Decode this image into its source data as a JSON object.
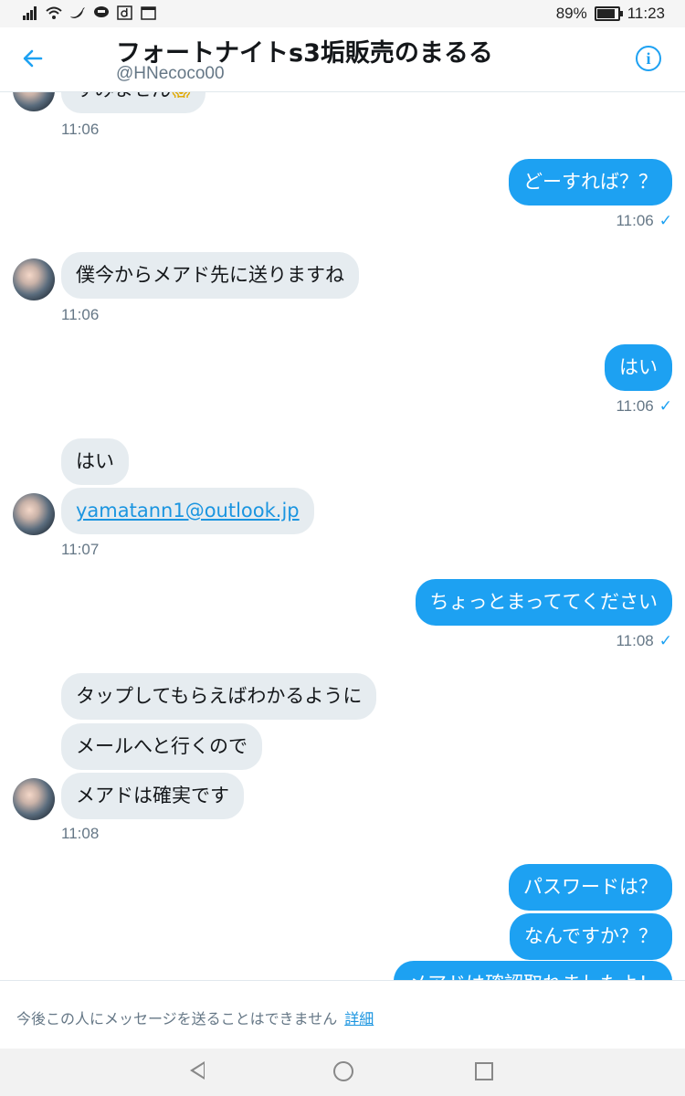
{
  "status_bar": {
    "battery": "89%",
    "time": "11:23"
  },
  "header": {
    "title": "フォートナイトs3垢販売のまるる",
    "handle": "@HNecoco00",
    "back_icon": "arrow-left-icon",
    "info_icon": "info-icon"
  },
  "messages": {
    "m0": {
      "text": "すみません",
      "time": "11:06"
    },
    "m1": {
      "text": "どーすれば？？",
      "time": "11:06"
    },
    "m2": {
      "text": "僕今からメアド先に送りますね",
      "time": "11:06"
    },
    "m3": {
      "text": "はい",
      "time": "11:06"
    },
    "m4": {
      "lines": [
        "はい",
        "yamatann1@outlook.jp"
      ],
      "time": "11:07"
    },
    "m5": {
      "text": "ちょっとまっててください",
      "time": "11:08"
    },
    "m6": {
      "lines": [
        "タップしてもらえばわかるように",
        "メールへと行くので",
        "メアドは確実です"
      ],
      "time": "11:08"
    },
    "m7": {
      "lines": [
        "パスワードは？",
        "なんですか？？",
        "メアドは確認取れましたよ！"
      ]
    }
  },
  "footer": {
    "notice": "今後この人にメッセージを送ることはできません",
    "link": "詳細"
  },
  "colors": {
    "accent": "#1da1f2",
    "received_bubble": "#e6ecf0",
    "muted": "#657786"
  }
}
